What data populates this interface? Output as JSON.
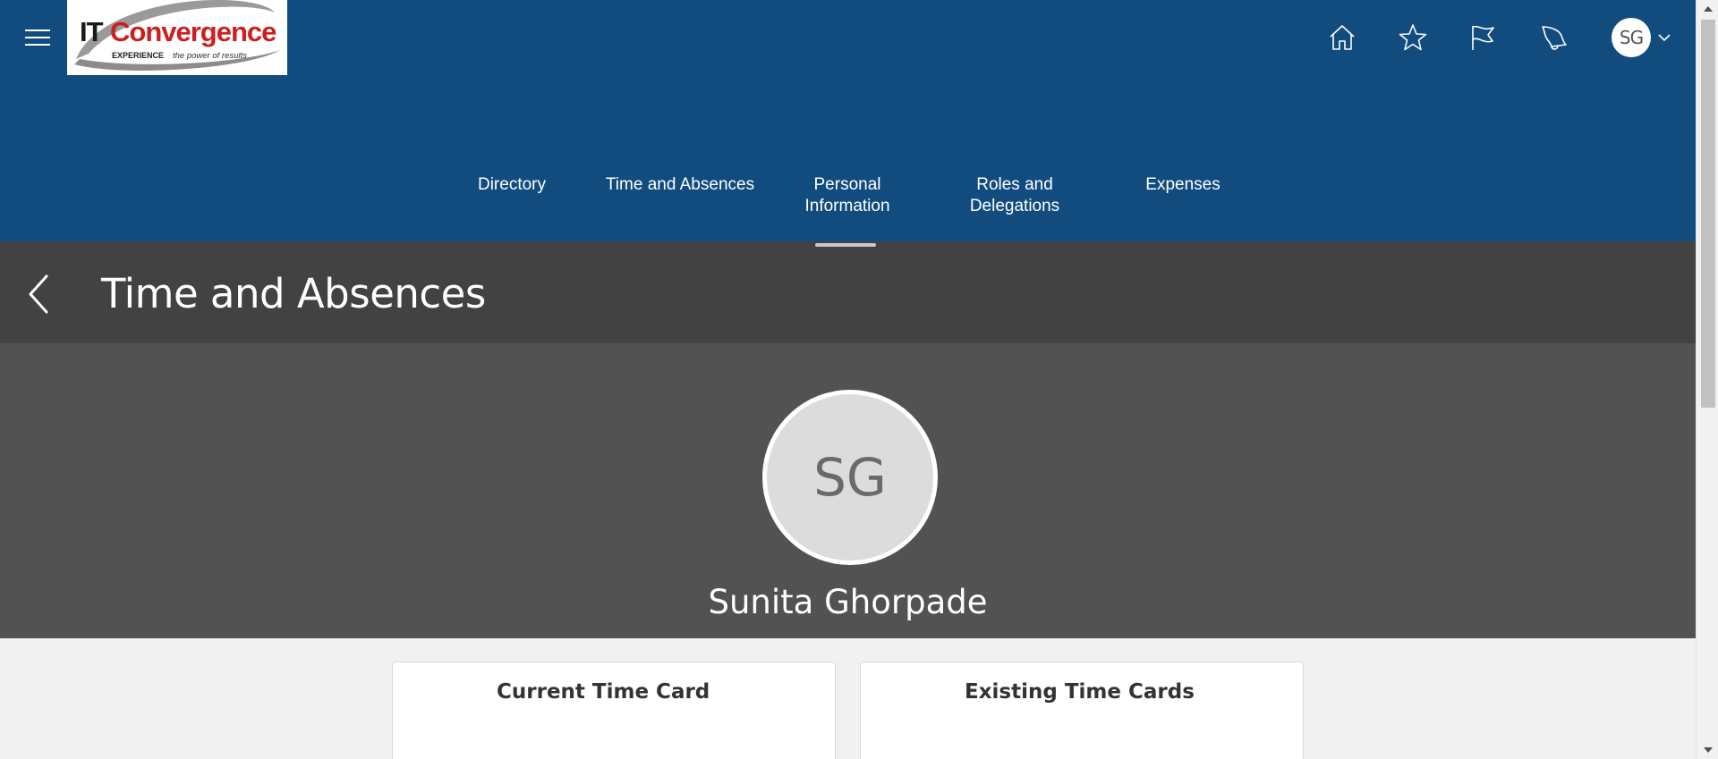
{
  "header": {
    "logo": {
      "brand_it": "IT",
      "brand_name": "Convergence",
      "tagline_bold": "EXPERIENCE",
      "tagline_rest": "the power of results"
    },
    "user_initials": "SG"
  },
  "nav": {
    "items": [
      {
        "label_line1": "Directory",
        "label_line2": ""
      },
      {
        "label_line1": "Time and Absences",
        "label_line2": ""
      },
      {
        "label_line1": "Personal",
        "label_line2": "Information"
      },
      {
        "label_line1": "Roles and",
        "label_line2": "Delegations"
      },
      {
        "label_line1": "Expenses",
        "label_line2": ""
      }
    ]
  },
  "title_bar": {
    "title": "Time and Absences"
  },
  "profile": {
    "initials": "SG",
    "name": "Sunita Ghorpade"
  },
  "cards": [
    {
      "title": "Current Time Card"
    },
    {
      "title": "Existing Time Cards"
    }
  ],
  "colors": {
    "header_bg": "#124c7e",
    "title_bar_bg": "#424242",
    "profile_bg": "#525252",
    "page_bg": "#f1f1f1",
    "logo_red": "#cc1f1f"
  },
  "icons": {
    "menu": "hamburger-icon",
    "home": "home-icon",
    "favorites": "star-icon",
    "watchlist": "flag-icon",
    "notifications": "bell-icon",
    "user_menu": "chevron-down-icon",
    "back": "chevron-left-icon"
  }
}
